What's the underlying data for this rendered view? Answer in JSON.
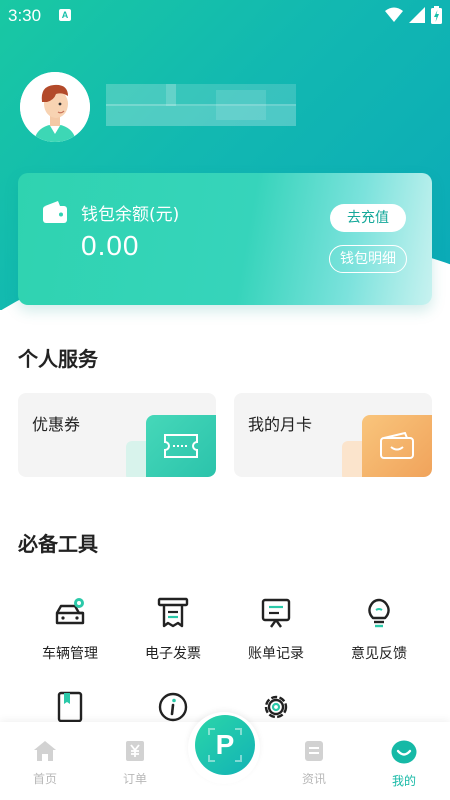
{
  "status_bar": {
    "time": "3:30",
    "indicator": "A"
  },
  "profile": {
    "avatar_icon": "user-avatar-illustration",
    "name_state": "blurred"
  },
  "wallet": {
    "label": "钱包余额(元)",
    "balance": "0.00",
    "recharge_label": "去充值",
    "detail_label": "钱包明细"
  },
  "personal_services": {
    "title": "个人服务",
    "items": [
      {
        "label": "优惠券",
        "icon": "ticket-icon",
        "color": "#34d1b0"
      },
      {
        "label": "我的月卡",
        "icon": "card-icon",
        "color": "#f6b46a"
      }
    ]
  },
  "tools": {
    "title": "必备工具",
    "items": [
      {
        "label": "车辆管理",
        "icon": "car-icon"
      },
      {
        "label": "电子发票",
        "icon": "receipt-icon"
      },
      {
        "label": "账单记录",
        "icon": "bill-icon"
      },
      {
        "label": "意见反馈",
        "icon": "lightbulb-icon"
      },
      {
        "label": "",
        "icon": "book-icon"
      },
      {
        "label": "",
        "icon": "info-icon"
      },
      {
        "label": "",
        "icon": "settings-icon"
      }
    ]
  },
  "bottom_nav": {
    "items": [
      {
        "label": "首页",
        "icon": "home-icon"
      },
      {
        "label": "订单",
        "icon": "order-icon"
      },
      {
        "label": "资讯",
        "icon": "news-icon"
      },
      {
        "label": "我的",
        "icon": "profile-icon",
        "active": true
      }
    ],
    "center_label": "P"
  },
  "colors": {
    "accent": "#16b9a6",
    "inactive": "#b8b8b8"
  }
}
